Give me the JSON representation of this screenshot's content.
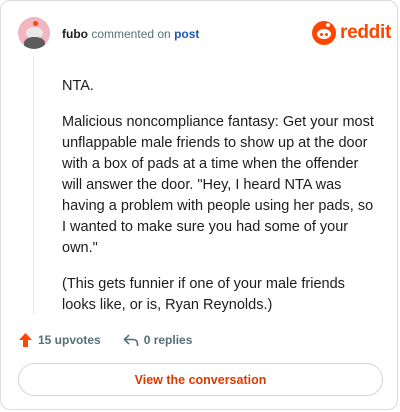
{
  "header": {
    "username": "fubo",
    "action_text": "commented on",
    "post_link": "post"
  },
  "logo": {
    "text": "reddit",
    "icon": "reddit-snoo-icon",
    "brand_color": "#ff4500"
  },
  "comment": {
    "paragraphs": [
      "NTA.",
      "Malicious noncompliance fantasy: Get your most unflappable male friends to show up at the door with a box of pads at a time when the offender will answer the door. \"Hey, I heard NTA was having a problem with people using her pads, so I wanted to make sure you had some of your own.\"",
      "(This gets funnier if one of your male friends looks like, or is, Ryan Reynolds.)"
    ]
  },
  "actions": {
    "upvotes": "15 upvotes",
    "upvote_icon": "upvote-arrow-icon",
    "replies": "0 replies",
    "reply_icon": "reply-arrow-icon"
  },
  "view_button": {
    "label": "View the conversation",
    "color": "#d93a00"
  }
}
